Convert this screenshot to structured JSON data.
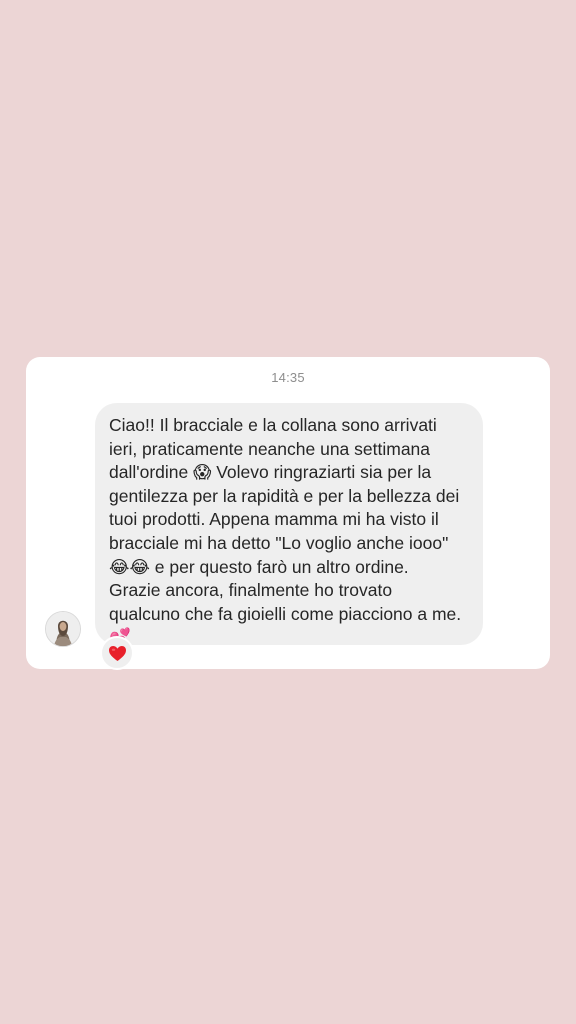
{
  "conversation": {
    "timestamp": "14:35",
    "message": {
      "text": "Ciao!! Il bracciale e la collana sono arrivati\nieri, praticamente neanche una settimana\ndall'ordine 😱 Volevo ringraziarti sia per la\ngentilezza per la rapidità e per la bellezza dei\ntuoi prodotti. Appena mamma mi ha visto il\nbracciale mi ha detto \"Lo voglio anche iooo\"\n😂😂 e per questo farò un altro ordine.\nGrazie ancora, finalmente ho trovato\nqualcuno che fa gioielli come piacciono a me.\n💕",
      "reaction_icon": "heart-icon"
    },
    "sender": {
      "avatar_icon": "profile-photo"
    }
  },
  "colors": {
    "background": "#ecd5d5",
    "card": "#ffffff",
    "bubble": "#efefef",
    "text": "#262626",
    "timestamp": "#8e8e8e",
    "reaction_heart": "#e8202a"
  }
}
